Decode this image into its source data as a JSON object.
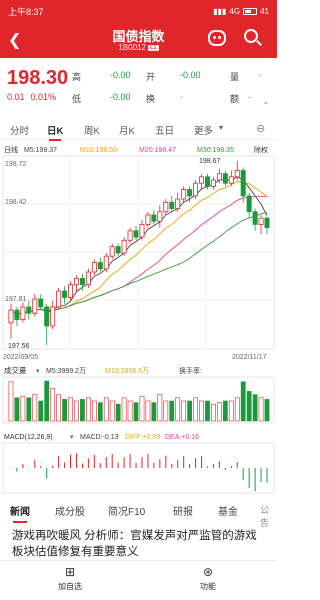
{
  "status": {
    "time": "上午8:37",
    "net": "4G",
    "battery": "41"
  },
  "header": {
    "title": "国债指数",
    "code": "1B0012",
    "code_tag": "L1"
  },
  "quote": {
    "price": "198.30",
    "change": "0.01",
    "pct": "0.01%",
    "fields": [
      {
        "label": "高",
        "value": "-0.00",
        "value_style": "green"
      },
      {
        "label": "开",
        "value": "-0.00",
        "value_style": "green"
      },
      {
        "label": "量",
        "value": "-",
        "value_style": "gray"
      },
      {
        "label": "低",
        "value": "-0.00",
        "value_style": "green"
      },
      {
        "label": "换",
        "value": "-",
        "value_style": "gray"
      },
      {
        "label": "额",
        "value": "-",
        "value_style": "gray"
      }
    ]
  },
  "period_tabs": [
    "分时",
    "日K",
    "周K",
    "月K",
    "五日",
    "更多"
  ],
  "active_period": "日K",
  "indicators": {
    "adjust": "日线",
    "ma5": "M5:198.37",
    "ma10": "M10:198.50",
    "ma20": "M20:198.47",
    "ma30": "M30:198.35",
    "exright": "除权"
  },
  "axis": {
    "y_high": "198.72",
    "y_mid": "198.42",
    "y_low": "197.81",
    "start_date": "2022/09/05",
    "end_date": "2022/11/17",
    "max_label": "198.67",
    "min_label": "197.56"
  },
  "volume": {
    "title": "成交量",
    "ma5": "M5:3999.2万",
    "ma10": "M10:2858.6万",
    "turnover": "换手率:"
  },
  "macd": {
    "title": "MACD(12,26,9)",
    "macd": "MACD:-0.13",
    "diff": "DIFF:+0.09",
    "dea": "DEA:+0.16"
  },
  "news_tabs": [
    "新闻",
    "成分股",
    "简况F10",
    "研报",
    "基金",
    "公告"
  ],
  "headline": "游戏再吹暖风 分析师：官媒发声对严监管的游戏板块估值修复有重要意义",
  "bottom_nav": [
    {
      "label": "加自选",
      "icon": "plus-square-icon"
    },
    {
      "label": "功能",
      "icon": "function-icon"
    }
  ],
  "colors": {
    "accent": "#e0262a",
    "up": "#e0262a",
    "down": "#1a9a3a",
    "ma5": "#444444",
    "ma10": "#e8a500",
    "ma20": "#e040a0",
    "ma30": "#30a030"
  },
  "chart_data": {
    "type": "candlestick",
    "y_range": [
      197.56,
      198.72
    ],
    "candles": [
      [
        197.7,
        197.78,
        197.6,
        197.82
      ],
      [
        197.78,
        197.72,
        197.68,
        197.8
      ],
      [
        197.72,
        197.8,
        197.7,
        197.83
      ],
      [
        197.8,
        197.76,
        197.72,
        197.84
      ],
      [
        197.76,
        197.85,
        197.74,
        197.88
      ],
      [
        197.85,
        197.8,
        197.78,
        197.88
      ],
      [
        197.8,
        197.68,
        197.56,
        197.82
      ],
      [
        197.68,
        197.8,
        197.66,
        197.84
      ],
      [
        197.8,
        197.9,
        197.78,
        197.92
      ],
      [
        197.9,
        197.86,
        197.82,
        197.93
      ],
      [
        197.86,
        197.94,
        197.84,
        197.96
      ],
      [
        197.94,
        197.98,
        197.9,
        198.0
      ],
      [
        197.98,
        197.94,
        197.9,
        198.01
      ],
      [
        197.94,
        198.02,
        197.92,
        198.04
      ],
      [
        198.02,
        198.08,
        198.0,
        198.1
      ],
      [
        198.08,
        198.04,
        198.02,
        198.11
      ],
      [
        198.04,
        198.12,
        198.02,
        198.14
      ],
      [
        198.12,
        198.18,
        198.1,
        198.2
      ],
      [
        198.18,
        198.14,
        198.12,
        198.2
      ],
      [
        198.14,
        198.22,
        198.12,
        198.24
      ],
      [
        198.22,
        198.28,
        198.2,
        198.3
      ],
      [
        198.28,
        198.24,
        198.22,
        198.31
      ],
      [
        198.24,
        198.32,
        198.22,
        198.35
      ],
      [
        198.32,
        198.38,
        198.3,
        198.4
      ],
      [
        198.38,
        198.34,
        198.32,
        198.41
      ],
      [
        198.34,
        198.4,
        198.3,
        198.44
      ],
      [
        198.4,
        198.46,
        198.38,
        198.48
      ],
      [
        198.46,
        198.42,
        198.4,
        198.5
      ],
      [
        198.42,
        198.48,
        198.4,
        198.52
      ],
      [
        198.48,
        198.54,
        198.46,
        198.56
      ],
      [
        198.54,
        198.5,
        198.46,
        198.56
      ],
      [
        198.5,
        198.58,
        198.48,
        198.6
      ],
      [
        198.58,
        198.62,
        198.54,
        198.64
      ],
      [
        198.62,
        198.56,
        198.54,
        198.64
      ],
      [
        198.56,
        198.6,
        198.54,
        198.62
      ],
      [
        198.6,
        198.64,
        198.58,
        198.67
      ],
      [
        198.64,
        198.58,
        198.56,
        198.66
      ],
      [
        198.58,
        198.62,
        198.56,
        198.66
      ],
      [
        198.62,
        198.66,
        198.6,
        198.72
      ],
      [
        198.66,
        198.5,
        198.46,
        198.68
      ],
      [
        198.5,
        198.4,
        198.36,
        198.52
      ],
      [
        198.4,
        198.32,
        198.28,
        198.42
      ],
      [
        198.32,
        198.36,
        198.26,
        198.38
      ],
      [
        198.36,
        198.3,
        198.26,
        198.37
      ]
    ]
  }
}
